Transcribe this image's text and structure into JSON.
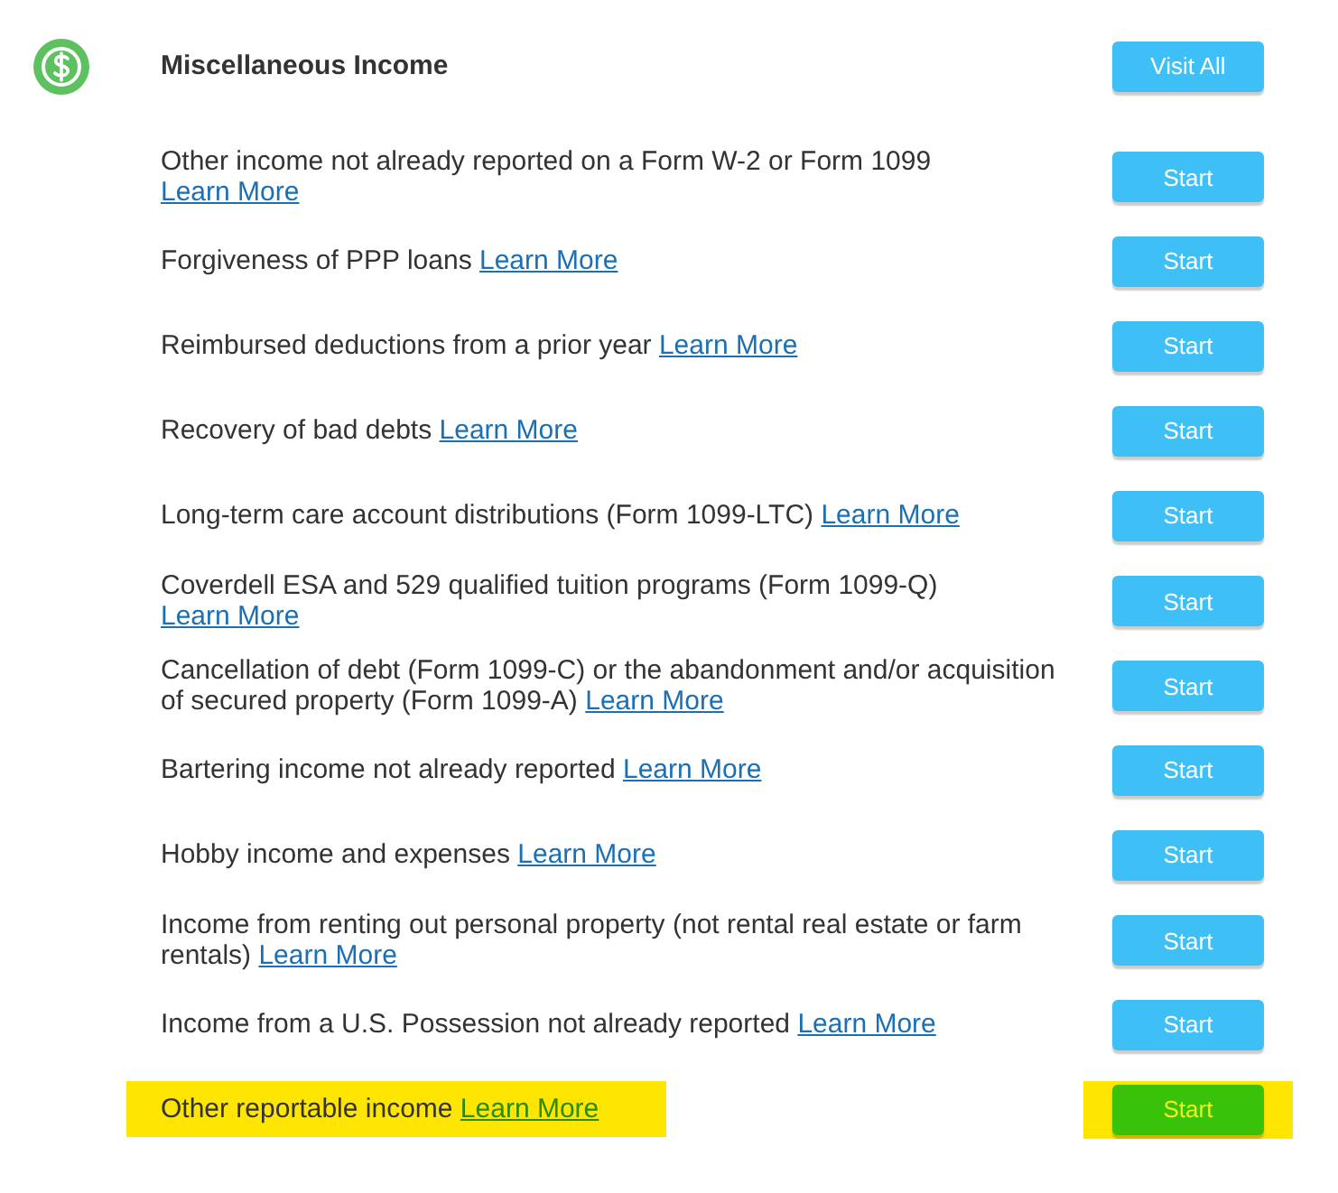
{
  "section": {
    "title": "Miscellaneous Income",
    "button": "Visit All"
  },
  "rows": [
    {
      "text": "Other income not already reported on a Form W-2 or Form 1099",
      "link": "Learn More",
      "button": "Start",
      "highlighted": false
    },
    {
      "text": "Forgiveness of PPP loans",
      "link": "Learn More",
      "button": "Start",
      "highlighted": false
    },
    {
      "text": "Reimbursed deductions from a prior year",
      "link": "Learn More",
      "button": "Start",
      "highlighted": false
    },
    {
      "text": "Recovery of bad debts",
      "link": "Learn More",
      "button": "Start",
      "highlighted": false
    },
    {
      "text": "Long-term care account distributions (Form 1099-LTC)",
      "link": "Learn More",
      "button": "Start",
      "highlighted": false
    },
    {
      "text": "Coverdell ESA and 529 qualified tuition programs (Form 1099-Q)",
      "link": "Learn More",
      "button": "Start",
      "highlighted": false
    },
    {
      "text": "Cancellation of debt (Form 1099-C) or the abandonment and/or acquisition of secured property (Form 1099-A)",
      "link": "Learn More",
      "button": "Start",
      "highlighted": false
    },
    {
      "text": "Bartering income not already reported",
      "link": "Learn More",
      "button": "Start",
      "highlighted": false
    },
    {
      "text": "Hobby income and expenses",
      "link": "Learn More",
      "button": "Start",
      "highlighted": false
    },
    {
      "text": "Income from renting out personal property (not rental real estate or farm rentals)",
      "link": "Learn More",
      "button": "Start",
      "highlighted": false
    },
    {
      "text": "Income from a U.S. Possession not already reported",
      "link": "Learn More",
      "button": "Start",
      "highlighted": false
    },
    {
      "text": "Other reportable income",
      "link": "Learn More",
      "button": "Start",
      "highlighted": true
    }
  ]
}
